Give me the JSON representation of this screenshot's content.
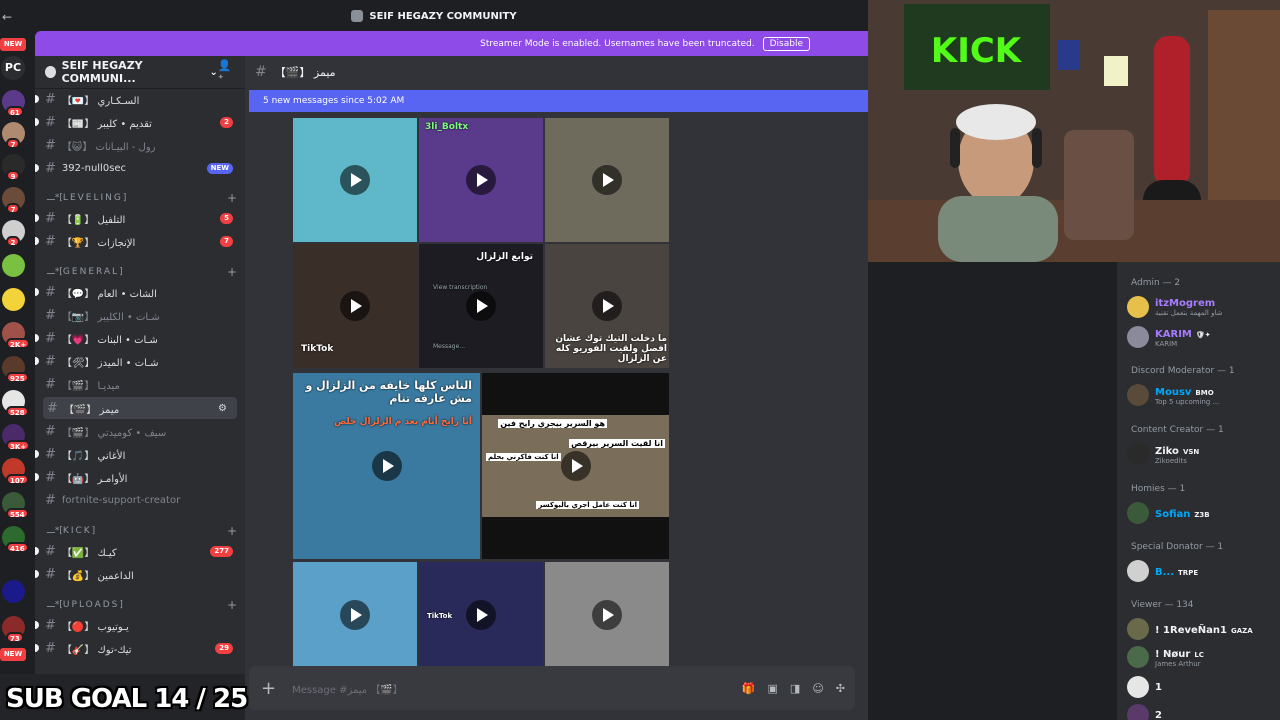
{
  "window": {
    "title": "SEIF HEGAZY COMMUNITY"
  },
  "streamer_banner": {
    "text": "Streamer Mode is enabled. Usernames have been truncated.",
    "button": "Disable"
  },
  "rail": {
    "new_top": "NEW",
    "pc": "PC",
    "badges": [
      "61",
      "7",
      "9",
      "7",
      "2",
      "2K+",
      "925",
      "528",
      "3K+",
      "107",
      "554",
      "416",
      "73",
      "NEW"
    ]
  },
  "server": {
    "name": "SEIF HEGAZY COMMUNI..."
  },
  "channels": [
    {
      "name": "السـكـاري 【💌】",
      "muted": false,
      "unread": true
    },
    {
      "name": "تقديم • كليبر 【📰】",
      "muted": false,
      "unread": true,
      "count": "2"
    },
    {
      "name": "رول - البيـانات 【😺】",
      "muted": true
    },
    {
      "name": "392-null0sec",
      "muted": false,
      "unread": true,
      "count": "NEW"
    },
    {
      "category": "ـــ*[LEVELING]"
    },
    {
      "name": "التلفيل 【🔋】",
      "muted": false,
      "unread": true,
      "count": "5"
    },
    {
      "name": "الإنجازات 【🏆】",
      "muted": false,
      "unread": true,
      "count": "7"
    },
    {
      "category": "ـــ*[GENERAL]"
    },
    {
      "name": "الشات • العام 【💬】",
      "muted": false,
      "unread": true
    },
    {
      "name": "شـات • الكليبر 【📷】",
      "muted": true
    },
    {
      "name": "شـات • البنات 【💗】",
      "muted": false,
      "unread": true
    },
    {
      "name": "شـات • الميدز 【🛠】",
      "muted": false,
      "unread": true
    },
    {
      "name": "ميديـا 【🎬】",
      "muted": true
    },
    {
      "name": "ميمز 【🎬】",
      "muted": false,
      "selected": true
    },
    {
      "name": "سيف • كوميدتي 【🎬】",
      "muted": true
    },
    {
      "name": "الأغاني 【🎵】",
      "muted": false,
      "unread": true
    },
    {
      "name": "الأوامـر 【🤖】",
      "muted": false,
      "unread": true
    },
    {
      "name": "fortnite-support-creator",
      "muted": true
    },
    {
      "category": "ـــ*[KICK]"
    },
    {
      "name": "كيـك 【✅】",
      "muted": false,
      "unread": true,
      "count": "277"
    },
    {
      "name": "الداعمين 【💰】",
      "muted": false,
      "unread": true
    },
    {
      "category": "ـــ*[UPLOADS]"
    },
    {
      "name": "يـوتيوب 【🔴】",
      "muted": false,
      "unread": true
    },
    {
      "name": "تيك-توك 【🎸】",
      "muted": false,
      "unread": true,
      "count": "29"
    }
  ],
  "channel_header": {
    "name": "ميمز 【🎬】"
  },
  "new_messages_bar": "5 new messages since 5:02 AM",
  "media_captions": {
    "m2_user": "3li_Boltx",
    "m5_title": "توابع الزلزال",
    "m5_line": "View transcription",
    "m5_msg": "Message...",
    "m6_caption": "ما دخلت التيك توك عشان افصل ولقيت الفوريو كله عن الزلزال",
    "m7_caption": "الناس كلها خايفه من الزلزال و مش عارفه تنام",
    "m7_caption2": "أنا رايح أنام بعد م الزلزال خلص",
    "m8_top": "هو السرير بيجري رايح فين",
    "m8_mid": "انا لقيت السرير بيرقص",
    "m8_bottom": "انا كنت فاكرني بحلم",
    "m8_foot": "انا كنت عامل اجري بالبوكسر",
    "tiktok": "TikTok"
  },
  "composer": {
    "placeholder": "Message #ميمز 【🎬】"
  },
  "member_list": [
    {
      "category": "Admin — 2"
    },
    {
      "name": "itzMogrem",
      "sub": "شاو المهمة بتعمل تقنية",
      "color": "#a97bff"
    },
    {
      "name": "KARIM",
      "sub": "KARIM",
      "tag": "🛡✦",
      "color": "#a97bff"
    },
    {
      "category": "Discord Moderator — 1"
    },
    {
      "name": "Mousv",
      "sub": "Top 5 upcoming ...",
      "tag": "BMO",
      "color": "#00a8fc"
    },
    {
      "category": "Content Creator — 1"
    },
    {
      "name": "Ziko",
      "sub": "Zikoedits",
      "tag": "VSN",
      "color": "#f2f3f5"
    },
    {
      "category": "Homies — 1"
    },
    {
      "name": "Sofian",
      "tag": "Z3B",
      "color": "#00a8fc"
    },
    {
      "category": "Special Donator — 1"
    },
    {
      "name": "B...",
      "tag": "TRPE",
      "color": "#00a8fc"
    },
    {
      "category": "Viewer — 134"
    },
    {
      "name": "! 1ReveÑan1",
      "tag": "GAZA",
      "color": "#f2f3f5"
    },
    {
      "name": "! Nøur",
      "sub": "James Arthur",
      "tag": "LC",
      "color": "#f2f3f5"
    },
    {
      "name": "1",
      "color": "#f2f3f5"
    },
    {
      "name": "2",
      "color": "#f2f3f5"
    }
  ],
  "overlay": {
    "sub_goal": "SUB GOAL 14 / 25"
  },
  "colors": {
    "accent": "#5865f2",
    "banner": "#8e4be8",
    "badge": "#f23f42"
  }
}
